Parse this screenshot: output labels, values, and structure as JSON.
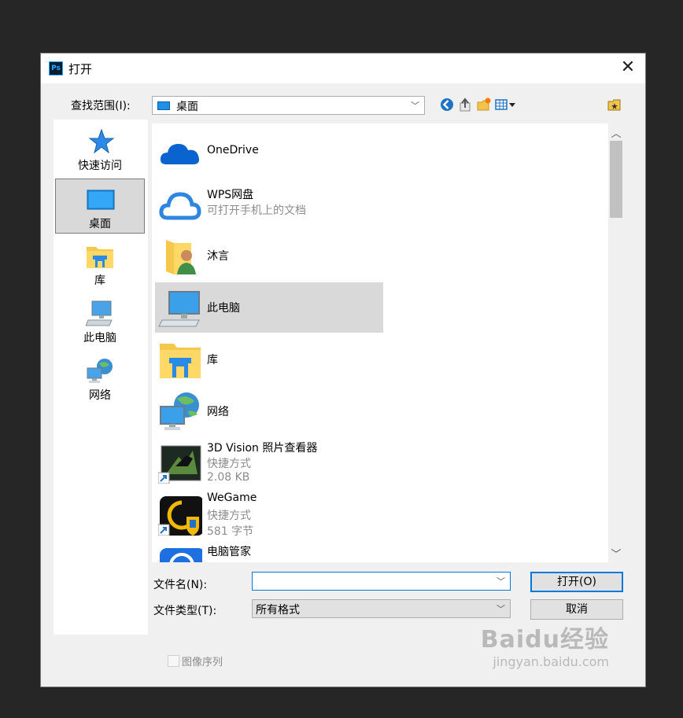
{
  "window": {
    "title": "打开",
    "app_icon": "Ps"
  },
  "lookin": {
    "label": "查找范围(I):",
    "value": "桌面"
  },
  "toolbar": {
    "icons": [
      "back-icon",
      "up-folder-icon",
      "new-folder-icon",
      "view-menu-icon",
      "bookmark-icon"
    ]
  },
  "places": [
    {
      "label": "快速访问",
      "icon": "star-icon"
    },
    {
      "label": "桌面",
      "icon": "desktop-icon",
      "selected": true
    },
    {
      "label": "库",
      "icon": "library-icon"
    },
    {
      "label": "此电脑",
      "icon": "computer-icon"
    },
    {
      "label": "网络",
      "icon": "network-icon"
    }
  ],
  "files": [
    {
      "name": "OneDrive",
      "icon": "onedrive-icon"
    },
    {
      "name": "WPS网盘",
      "sub1": "可打开手机上的文档",
      "icon": "cloud-icon"
    },
    {
      "name": "沐言",
      "icon": "user-folder-icon"
    },
    {
      "name": "此电脑",
      "icon": "computer-icon",
      "selected": true
    },
    {
      "name": "库",
      "icon": "library-icon"
    },
    {
      "name": "网络",
      "icon": "network-icon"
    },
    {
      "name": "3D Vision 照片查看器",
      "sub1": "快捷方式",
      "sub2": "2.08 KB",
      "icon": "3d-vision-icon"
    },
    {
      "name": "WeGame",
      "sub1": "快捷方式",
      "sub2": "581 字节",
      "icon": "wegame-icon"
    },
    {
      "name": "电脑管家",
      "icon": "pc-manager-icon"
    }
  ],
  "form": {
    "filename_label": "文件名(N):",
    "filename_value": "",
    "filetype_label": "文件类型(T):",
    "filetype_value": "所有格式",
    "open_button": "打开(O)",
    "cancel_button": "取消",
    "sequence_label": "图像序列"
  },
  "watermark": {
    "line1": "Baidu经验",
    "line2": "jingyan.baidu.com"
  }
}
